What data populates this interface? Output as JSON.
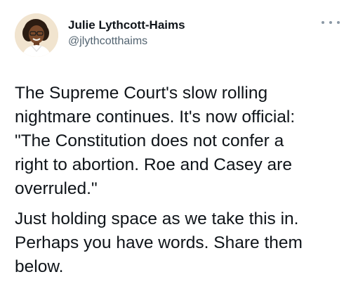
{
  "author": {
    "display_name": "Julie Lythcott-Haims",
    "handle": "@jlythcotthaims"
  },
  "tweet": {
    "paragraph_1": "The Supreme Court's slow rolling\nnightmare continues. It's now official:\n\"The Constitution does not confer a\nright to abortion. Roe and Casey are\noverruled.\"",
    "paragraph_2": "Just holding space as we take this in.\nPerhaps you have words. Share them\nbelow."
  },
  "icons": {
    "more": "more-horizontal-icon"
  }
}
